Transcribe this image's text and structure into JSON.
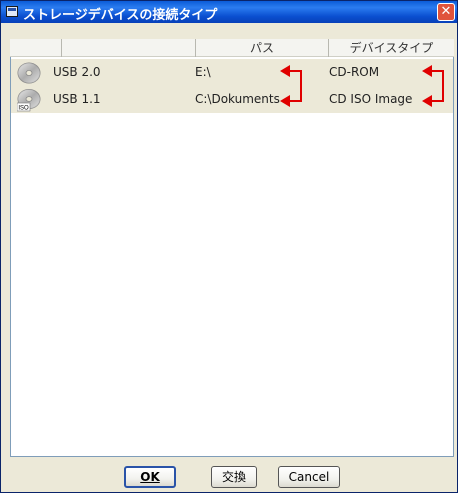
{
  "window": {
    "title": "ストレージデバイスの接続タイプ",
    "close_label": "✕"
  },
  "table": {
    "columns": [
      "",
      "",
      "パス",
      "デバイスタイプ"
    ],
    "rows": [
      {
        "icon": "cd-disc-icon",
        "name": "USB 2.0",
        "path": "E:\\",
        "device_type": "CD-ROM"
      },
      {
        "icon": "cd-iso-disc-icon",
        "name": "USB 1.1",
        "path": "C:\\Dokuments",
        "device_type": "CD ISO Image",
        "badge": "ISO"
      }
    ]
  },
  "buttons": {
    "ok": "OK",
    "swap": "交換",
    "cancel": "Cancel"
  },
  "colors": {
    "title_bar": "#0a4fd0",
    "row_background": "#ece9d8",
    "annotation_red": "#e00000"
  }
}
